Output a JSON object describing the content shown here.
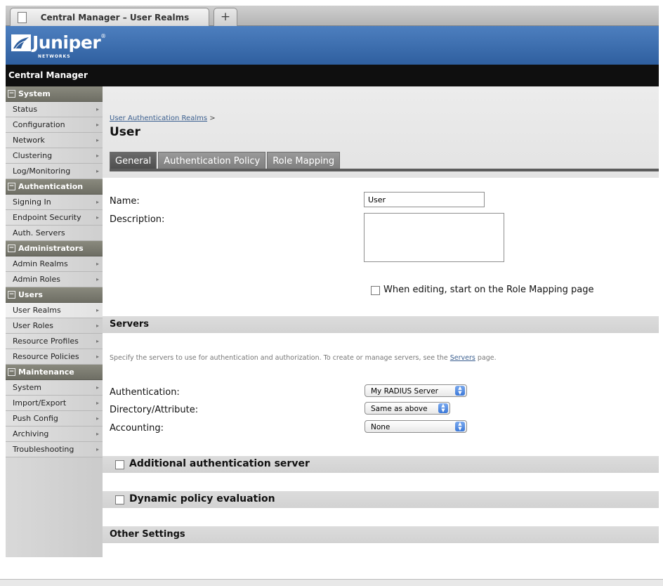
{
  "browser": {
    "tab_title": "Central Manager – User Realms",
    "new_tab": "+"
  },
  "brand": {
    "logo_text": "Juniper",
    "logo_sub": "NETWORKS",
    "logo_reg": "®"
  },
  "header": {
    "title": "Central Manager"
  },
  "sidebar": {
    "sections": [
      {
        "title": "System",
        "items": [
          "Status",
          "Configuration",
          "Network",
          "Clustering",
          "Log/Monitoring"
        ]
      },
      {
        "title": "Authentication",
        "items": [
          "Signing In",
          "Endpoint Security",
          "Auth. Servers"
        ]
      },
      {
        "title": "Administrators",
        "items": [
          "Admin Realms",
          "Admin Roles"
        ]
      },
      {
        "title": "Users",
        "items": [
          "User Realms",
          "User Roles",
          "Resource Profiles",
          "Resource Policies"
        ]
      },
      {
        "title": "Maintenance",
        "items": [
          "System",
          "Import/Export",
          "Push Config",
          "Archiving",
          "Troubleshooting"
        ]
      }
    ],
    "active_item": "User Realms"
  },
  "main": {
    "breadcrumb_link": "User Authentication Realms",
    "breadcrumb_sep": ">",
    "title": "User",
    "tabs": [
      "General",
      "Authentication Policy",
      "Role Mapping"
    ],
    "active_tab": "General",
    "form": {
      "name_label": "Name:",
      "name_value": "User",
      "description_label": "Description:",
      "description_value": "",
      "edit_option_label": "When editing, start on the Role Mapping page"
    },
    "servers": {
      "title": "Servers",
      "note_prefix": "Specify the servers to use for authentication and authorization. To create or manage servers, see the",
      "note_link": "Servers",
      "note_suffix": "page.",
      "authentication_label": "Authentication:",
      "authentication_value": "My RADIUS Server",
      "directory_label": "Directory/Attribute:",
      "directory_value": "Same as above",
      "accounting_label": "Accounting:",
      "accounting_value": "None"
    },
    "additional_auth_label": "Additional authentication server",
    "dynamic_policy_label": "Dynamic policy evaluation",
    "other_settings_title": "Other Settings"
  }
}
